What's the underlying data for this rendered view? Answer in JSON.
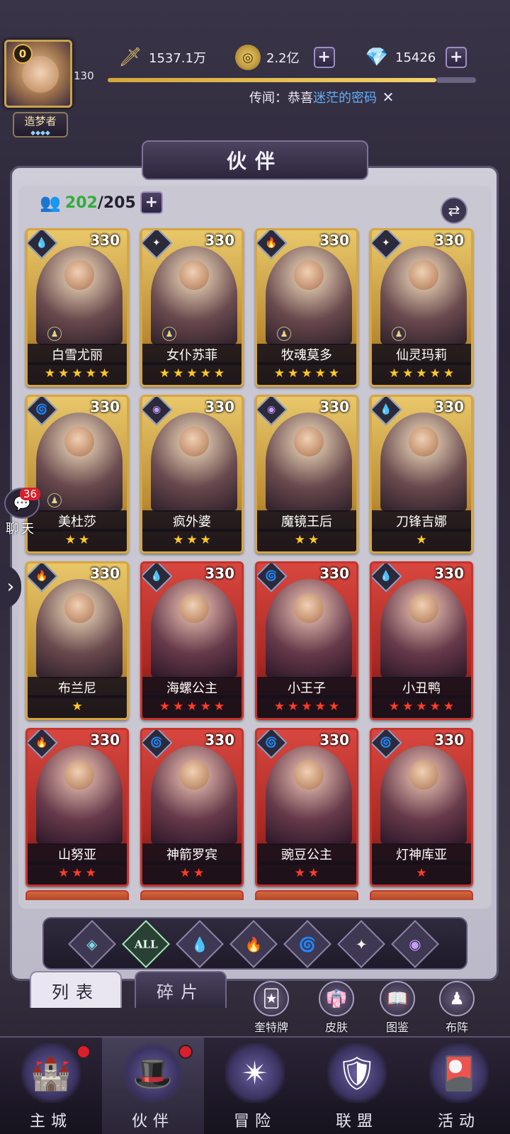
{
  "player": {
    "level_badge": "0",
    "level": "130",
    "rank_title": "造梦者",
    "rank_dots": "◆◆◆◆"
  },
  "resources": [
    {
      "name": "sword-power",
      "icon": "sword-icon",
      "value": "1537.1万"
    },
    {
      "name": "gold",
      "icon": "gold-coin-icon",
      "value": "2.2亿"
    },
    {
      "name": "diamond",
      "icon": "diamond-icon",
      "value": "15426"
    }
  ],
  "news": {
    "prefix": "传闻：恭喜",
    "highlight": "迷茫的密码"
  },
  "title": "伙伴",
  "partner_count": {
    "current": "202",
    "sep": "/205"
  },
  "accent": {
    "gold": "#d6a640",
    "red": "#c6342c",
    "star_yellow": "#ffc928",
    "star_red": "#ff3c28"
  },
  "cards": [
    {
      "name": "白雪尤丽",
      "level": "330",
      "element": "water",
      "frame": "gold",
      "stars": 5,
      "star_color": "yellow",
      "pawn": true
    },
    {
      "name": "女仆苏菲",
      "level": "330",
      "element": "light",
      "frame": "gold",
      "stars": 5,
      "star_color": "yellow",
      "pawn": true
    },
    {
      "name": "牧魂莫多",
      "level": "330",
      "element": "fire",
      "frame": "gold",
      "stars": 5,
      "star_color": "yellow",
      "pawn": true
    },
    {
      "name": "仙灵玛莉",
      "level": "330",
      "element": "light",
      "frame": "gold",
      "stars": 5,
      "star_color": "yellow",
      "pawn": true
    },
    {
      "name": "美杜莎",
      "level": "330",
      "element": "wind",
      "frame": "gold",
      "stars": 2,
      "star_color": "yellow",
      "pawn": true
    },
    {
      "name": "疯外婆",
      "level": "330",
      "element": "dark",
      "frame": "gold",
      "stars": 3,
      "star_color": "yellow",
      "pawn": false
    },
    {
      "name": "魔镜王后",
      "level": "330",
      "element": "dark",
      "frame": "gold",
      "stars": 2,
      "star_color": "yellow",
      "pawn": false
    },
    {
      "name": "刀锋吉娜",
      "level": "330",
      "element": "water",
      "frame": "gold",
      "stars": 1,
      "star_color": "yellow",
      "pawn": false
    },
    {
      "name": "布兰尼",
      "level": "330",
      "element": "fire",
      "frame": "gold",
      "stars": 1,
      "star_color": "yellow",
      "pawn": false
    },
    {
      "name": "海螺公主",
      "level": "330",
      "element": "water",
      "frame": "red",
      "stars": 5,
      "star_color": "red",
      "pawn": false
    },
    {
      "name": "小王子",
      "level": "330",
      "element": "wind",
      "frame": "red",
      "stars": 5,
      "star_color": "red",
      "pawn": false
    },
    {
      "name": "小丑鸭",
      "level": "330",
      "element": "water",
      "frame": "red",
      "stars": 5,
      "star_color": "red",
      "pawn": false
    },
    {
      "name": "山努亚",
      "level": "330",
      "element": "fire",
      "frame": "red",
      "stars": 3,
      "star_color": "red",
      "pawn": false
    },
    {
      "name": "神箭罗宾",
      "level": "330",
      "element": "wind",
      "frame": "red",
      "stars": 2,
      "star_color": "red",
      "pawn": false
    },
    {
      "name": "豌豆公主",
      "level": "330",
      "element": "wind",
      "frame": "red",
      "stars": 2,
      "star_color": "red",
      "pawn": false
    },
    {
      "name": "灯神库亚",
      "level": "330",
      "element": "wind",
      "frame": "red",
      "stars": 1,
      "star_color": "red",
      "pawn": false
    }
  ],
  "filters": [
    {
      "name": "filter-all-elements",
      "label": "",
      "icon": "eye-diamond-icon"
    },
    {
      "name": "filter-all",
      "label": "ALL",
      "icon": ""
    },
    {
      "name": "filter-water",
      "label": "",
      "icon": "water-drop-icon"
    },
    {
      "name": "filter-fire",
      "label": "",
      "icon": "flame-icon"
    },
    {
      "name": "filter-wind",
      "label": "",
      "icon": "wind-swirl-icon"
    },
    {
      "name": "filter-light",
      "label": "",
      "icon": "star-burst-icon"
    },
    {
      "name": "filter-dark",
      "label": "",
      "icon": "eye-icon"
    }
  ],
  "tabs": {
    "list": "列表",
    "fragments": "碎片"
  },
  "quick_buttons": [
    {
      "label": "奎特牌",
      "icon": "cards-icon"
    },
    {
      "label": "皮肤",
      "icon": "outfit-icon"
    },
    {
      "label": "图鉴",
      "icon": "codex-icon"
    },
    {
      "label": "布阵",
      "icon": "chess-icon"
    }
  ],
  "chat": {
    "count": "36",
    "label": "聊天"
  },
  "nav": [
    {
      "label": "主城",
      "icon": "castle-icon",
      "dot": true
    },
    {
      "label": "伙伴",
      "icon": "wizard-hat-icon",
      "dot": true
    },
    {
      "label": "冒险",
      "icon": "compass-icon",
      "dot": false
    },
    {
      "label": "联盟",
      "icon": "shield-icon",
      "dot": false
    },
    {
      "label": "活动",
      "icon": "cards-icon",
      "dot": false
    }
  ]
}
